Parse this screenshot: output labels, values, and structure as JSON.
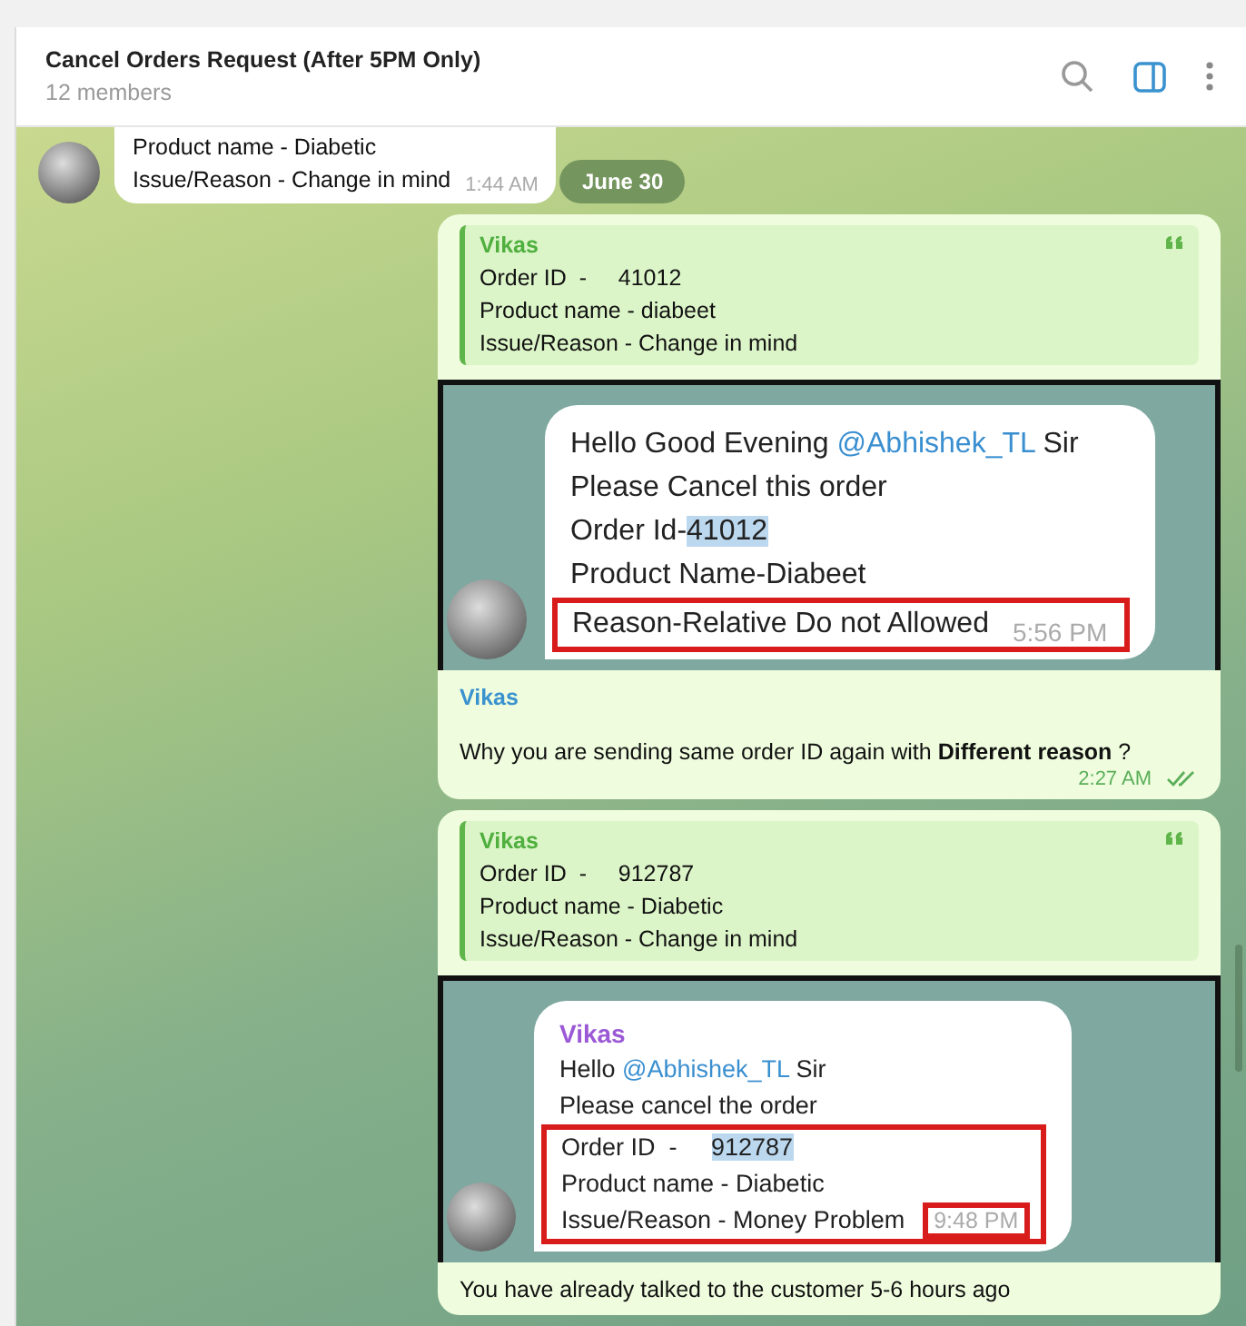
{
  "header": {
    "title": "Cancel Orders Request (After 5PM Only)",
    "subtitle": "12 members"
  },
  "date_badge": "June 30",
  "messages": [
    {
      "kind": "incoming",
      "lines": [
        "Product name - Diabetic",
        "Issue/Reason - Change in mind"
      ],
      "time": "1:44 AM"
    },
    {
      "kind": "outgoing",
      "quote": {
        "author": "Vikas",
        "lines": [
          "Order ID  -     41012",
          "Product name - diabeet",
          "Issue/Reason - Change in mind"
        ]
      },
      "screenshot": {
        "lines": [
          {
            "highlighted": false,
            "segments": [
              {
                "kind": "text",
                "text": "Hello Good Evening "
              },
              {
                "kind": "mention",
                "text": "@Abhishek_TL"
              },
              {
                "kind": "text",
                "text": " Sir"
              }
            ]
          },
          {
            "highlighted": false,
            "segments": [
              {
                "kind": "text",
                "text": "Please Cancel this order"
              }
            ]
          },
          {
            "highlighted": false,
            "segments": [
              {
                "kind": "text",
                "text": "Order Id-"
              },
              {
                "kind": "selected",
                "text": "41012"
              }
            ]
          },
          {
            "highlighted": false,
            "segments": [
              {
                "kind": "text",
                "text": "Product Name-Diabeet"
              }
            ]
          },
          {
            "highlighted": true,
            "segments": [
              {
                "kind": "text",
                "text": "Reason-Relative Do not Allowed"
              }
            ]
          }
        ],
        "time": "5:56 PM",
        "time_highlighted": false
      },
      "author": "Vikas",
      "text": "Why you are sending same order ID again with **Different reason** ?",
      "time": "2:27 AM",
      "read": true
    },
    {
      "kind": "outgoing",
      "quote": {
        "author": "Vikas",
        "lines": [
          "Order ID  -     912787",
          "Product name - Diabetic",
          "Issue/Reason - Change in mind"
        ]
      },
      "screenshot": {
        "author": "Vikas",
        "lines": [
          {
            "highlighted": false,
            "segments": [
              {
                "kind": "text",
                "text": "Hello "
              },
              {
                "kind": "mention",
                "text": "@Abhishek_TL"
              },
              {
                "kind": "text",
                "text": " Sir"
              }
            ]
          },
          {
            "highlighted": false,
            "segments": [
              {
                "kind": "text",
                "text": "Please cancel the order"
              }
            ]
          },
          {
            "highlighted": true,
            "segments": [
              {
                "kind": "text",
                "text": "Order ID  -     "
              },
              {
                "kind": "selected",
                "text": "912787"
              }
            ]
          },
          {
            "highlighted": true,
            "segments": [
              {
                "kind": "text",
                "text": "Product name - Diabetic"
              }
            ]
          },
          {
            "highlighted": true,
            "segments": [
              {
                "kind": "text",
                "text": "Issue/Reason - Money Problem"
              }
            ]
          }
        ],
        "time": "9:48 PM",
        "time_highlighted": true
      },
      "text": "You have already talked to the customer 5-6 hours ago"
    }
  ]
}
